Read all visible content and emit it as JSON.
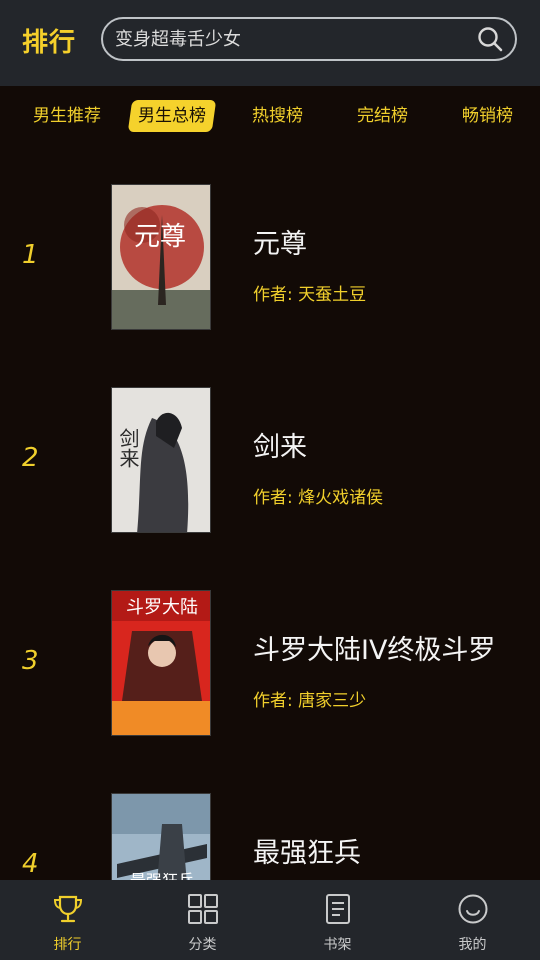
{
  "header": {
    "title": "排行",
    "search_placeholder": "变身超毒舌少女"
  },
  "tabs": [
    {
      "label": "男生推荐",
      "active": false
    },
    {
      "label": "男生总榜",
      "active": true
    },
    {
      "label": "热搜榜",
      "active": false
    },
    {
      "label": "完结榜",
      "active": false
    },
    {
      "label": "畅销榜",
      "active": false
    }
  ],
  "books": [
    {
      "rank": "1",
      "title": "元尊",
      "author": "作者: 天蚕土豆",
      "cover_text": "元尊"
    },
    {
      "rank": "2",
      "title": "剑来",
      "author": "作者: 烽火戏诸侯",
      "cover_text": "剑来"
    },
    {
      "rank": "3",
      "title": "斗罗大陆IV终极斗罗",
      "author": "作者: 唐家三少",
      "cover_text": "斗罗大陆"
    },
    {
      "rank": "4",
      "title": "最强狂兵",
      "author": "",
      "cover_text": "最强狂兵"
    }
  ],
  "bottom_nav": [
    {
      "label": "排行",
      "icon": "trophy-icon",
      "active": true
    },
    {
      "label": "分类",
      "icon": "grid-icon",
      "active": false
    },
    {
      "label": "书架",
      "icon": "bookshelf-icon",
      "active": false
    },
    {
      "label": "我的",
      "icon": "smiley-icon",
      "active": false
    }
  ],
  "colors": {
    "accent": "#f5d22c",
    "background": "#120a06",
    "bar": "#23262b"
  }
}
